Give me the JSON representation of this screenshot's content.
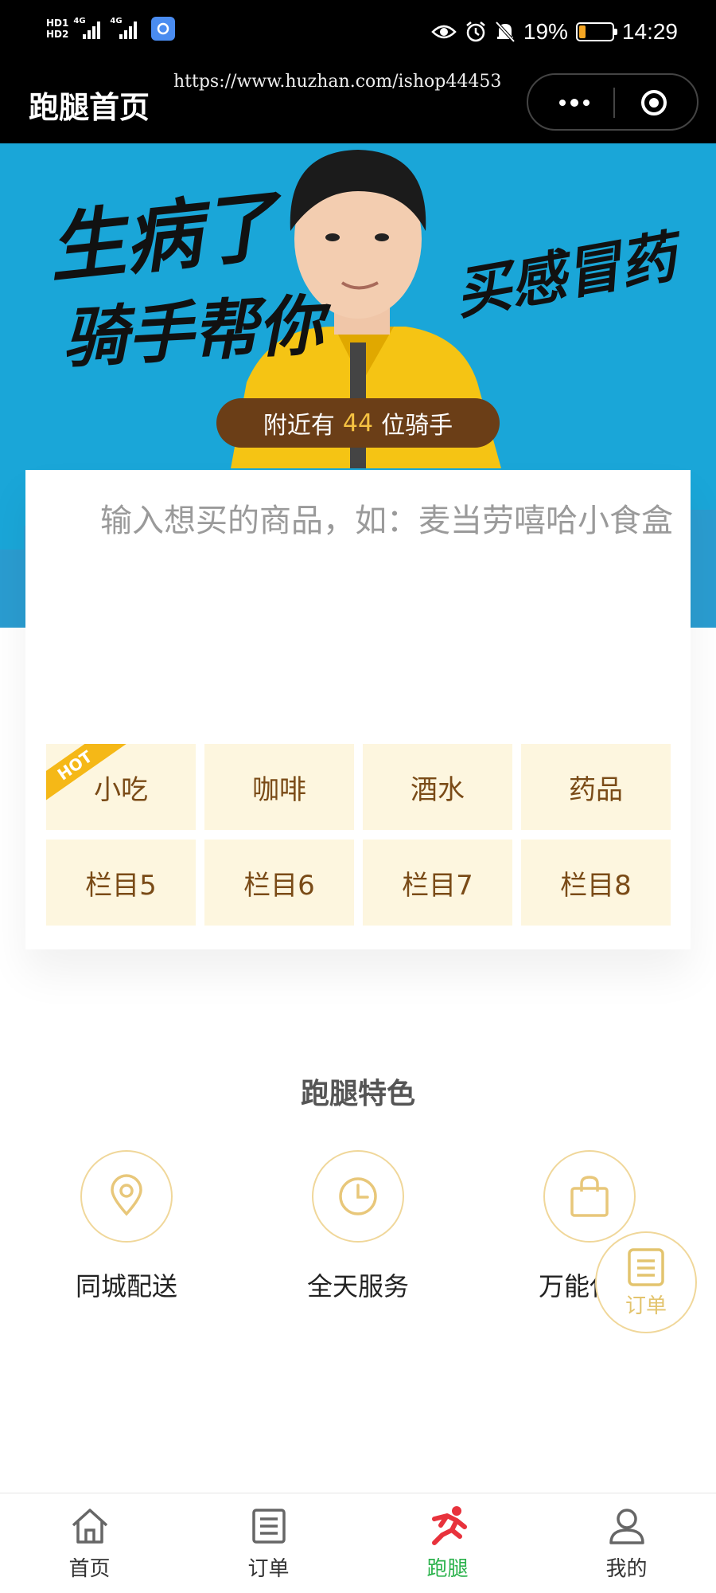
{
  "status_bar": {
    "hd1": "HD1",
    "hd2": "HD2",
    "net1": "4G",
    "net2": "4G",
    "battery_percent": "19%",
    "battery_level": 0.19,
    "time": "14:29"
  },
  "title_bar": {
    "title": "跑腿首页",
    "watermark": "https://www.huzhan.com/ishop44453"
  },
  "banner": {
    "slogan_line1": "生病了",
    "slogan_line2": "骑手帮你",
    "slogan_right": "买感冒药",
    "riders_prefix": "附近有",
    "riders_count": "44",
    "riders_suffix": "位骑手"
  },
  "search": {
    "placeholder": "输入想买的商品，如：麦当劳嘻哈小食盒"
  },
  "categories": [
    {
      "label": "小吃",
      "badge": "HOT"
    },
    {
      "label": "咖啡"
    },
    {
      "label": "酒水"
    },
    {
      "label": "药品"
    },
    {
      "label": "栏目5"
    },
    {
      "label": "栏目6"
    },
    {
      "label": "栏目7"
    },
    {
      "label": "栏目8"
    }
  ],
  "features": {
    "title": "跑腿特色",
    "items": [
      {
        "label": "同城配送",
        "icon": "location-pin-icon"
      },
      {
        "label": "全天服务",
        "icon": "clock-icon"
      },
      {
        "label": "万能代购",
        "icon": "shopping-bag-icon"
      }
    ]
  },
  "float_button": {
    "label": "订单",
    "icon": "order-list-icon"
  },
  "tabs": [
    {
      "label": "首页",
      "icon": "home-icon"
    },
    {
      "label": "订单",
      "icon": "list-icon"
    },
    {
      "label": "跑腿",
      "icon": "runner-icon",
      "active": true
    },
    {
      "label": "我的",
      "icon": "user-icon"
    }
  ],
  "colors": {
    "accent_green": "#2bb24c",
    "banner_blue": "#1aa6d8",
    "category_bg": "#fdf6df",
    "category_text": "#7a4b17",
    "feature_gold": "#e3c46e",
    "hot_ribbon": "#f5b817"
  }
}
